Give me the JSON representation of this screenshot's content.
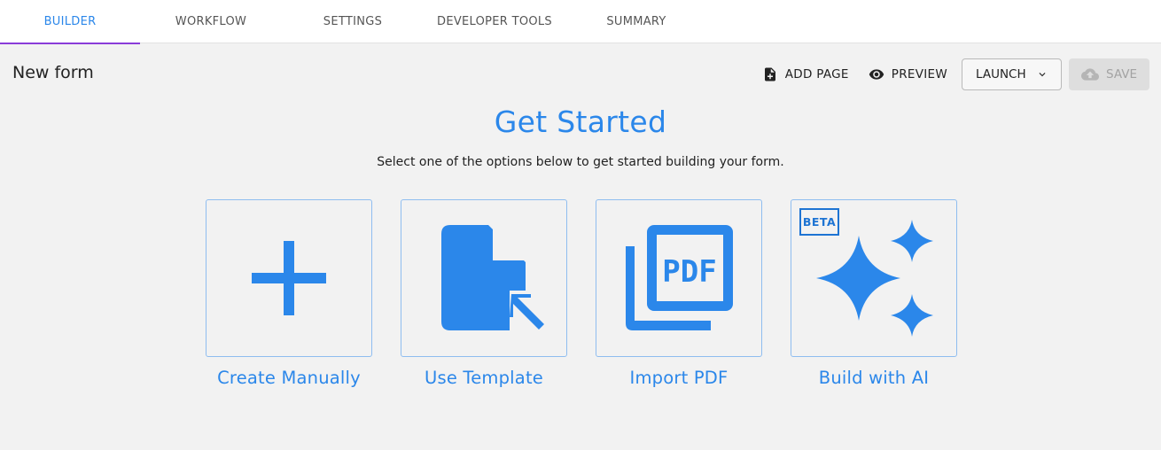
{
  "tabs": [
    {
      "label": "BUILDER",
      "active": true
    },
    {
      "label": "WORKFLOW",
      "active": false
    },
    {
      "label": "SETTINGS",
      "active": false
    },
    {
      "label": "DEVELOPER TOOLS",
      "active": false
    },
    {
      "label": "SUMMARY",
      "active": false
    }
  ],
  "header": {
    "form_title": "New form",
    "add_page_label": "ADD PAGE",
    "preview_label": "PREVIEW",
    "launch_label": "LAUNCH",
    "save_label": "SAVE"
  },
  "hero": {
    "title": "Get Started",
    "subtitle": "Select one of the options below to get started building your form."
  },
  "options": [
    {
      "label": "Create Manually",
      "icon": "plus-icon"
    },
    {
      "label": "Use Template",
      "icon": "template-file-icon"
    },
    {
      "label": "Import PDF",
      "icon": "pdf-icon"
    },
    {
      "label": "Build with AI",
      "icon": "sparkles-icon",
      "badge": "BETA"
    }
  ],
  "colors": {
    "accent": "#2b87ea",
    "tab_indicator": "#8a3bd9",
    "card_border": "#8fbdf0",
    "background": "#f2f2f2"
  }
}
